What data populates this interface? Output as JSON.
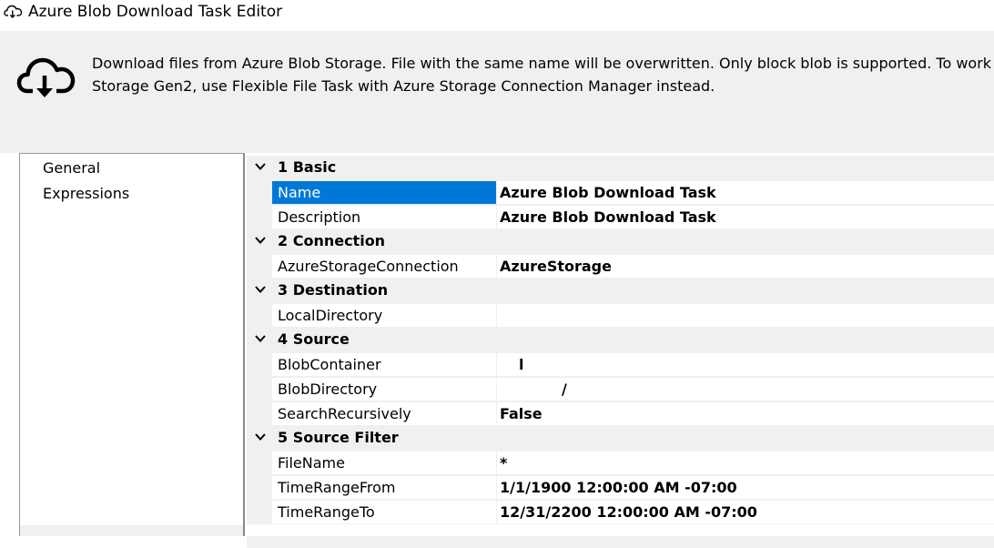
{
  "window": {
    "title": "Azure Blob Download Task Editor",
    "icon": "cloud-download-icon"
  },
  "header": {
    "icon": "cloud-download-icon",
    "description_line1": "Download files from Azure Blob Storage. File with the same name will be overwritten. Only block blob is supported. To work w",
    "description_line2": "Storage Gen2, use Flexible File Task with Azure Storage Connection Manager instead."
  },
  "nav": {
    "items": [
      {
        "label": "General",
        "selected": true
      },
      {
        "label": "Expressions",
        "selected": false
      }
    ]
  },
  "grid": {
    "selection_color": "#0078d7",
    "categories": [
      {
        "label": "1 Basic",
        "properties": [
          {
            "name": "Name",
            "value": "Azure Blob Download Task",
            "selected": true
          },
          {
            "name": "Description",
            "value": "Azure Blob Download Task"
          }
        ]
      },
      {
        "label": "2 Connection",
        "properties": [
          {
            "name": "AzureStorageConnection",
            "value": "AzureStorage"
          }
        ]
      },
      {
        "label": "3 Destination",
        "properties": [
          {
            "name": "LocalDirectory",
            "value": ""
          }
        ]
      },
      {
        "label": "4 Source",
        "properties": [
          {
            "name": "BlobContainer",
            "value": "l"
          },
          {
            "name": "BlobDirectory",
            "value": "/"
          },
          {
            "name": "SearchRecursively",
            "value": "False"
          }
        ]
      },
      {
        "label": "5 Source Filter",
        "properties": [
          {
            "name": "FileName",
            "value": "*"
          },
          {
            "name": "TimeRangeFrom",
            "value": "1/1/1900 12:00:00 AM -07:00"
          },
          {
            "name": "TimeRangeTo",
            "value": "12/31/2200 12:00:00 AM -07:00"
          }
        ]
      }
    ]
  }
}
